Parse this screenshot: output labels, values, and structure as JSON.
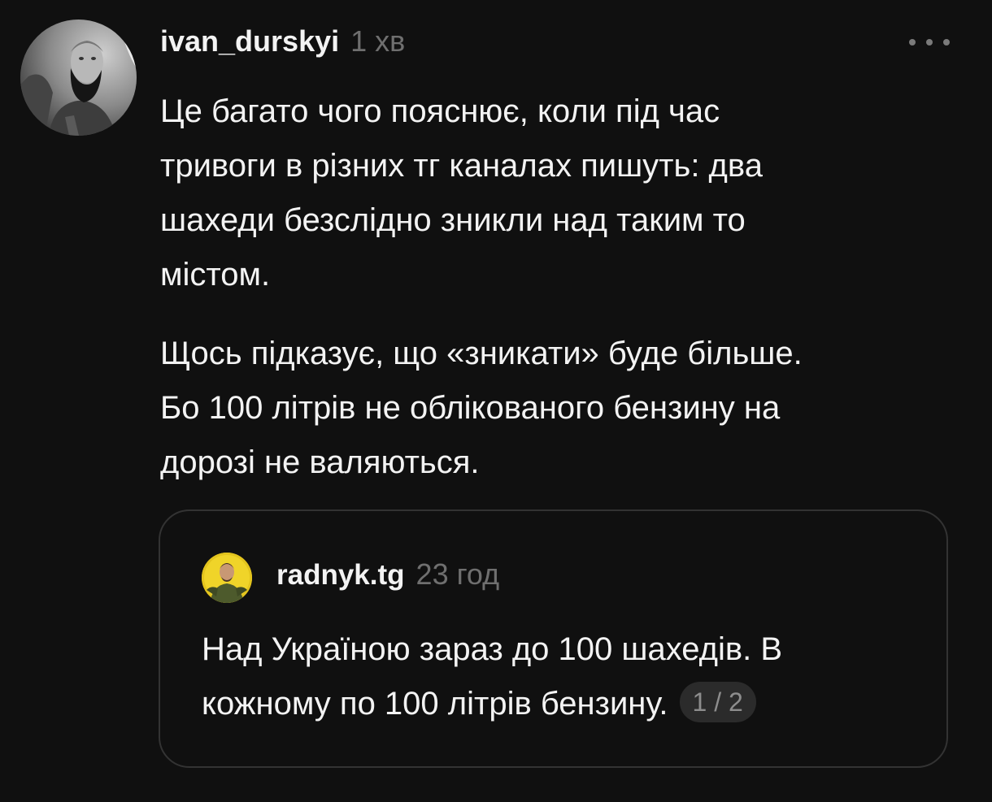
{
  "post": {
    "username": "ivan_durskyi",
    "timestamp": "1 хв",
    "paragraphs": [
      "Це багато чого пояснює, коли під час\nтривоги в різних тг каналах пишуть: два\nшахеди безслідно зникли над таким то\nмістом.",
      "Щось підказує, що «зникати» буде більше.\nБо 100 літрів не облікованого бензину на\nдорозі не валяються."
    ],
    "more_icon": "more-horizontal-icon"
  },
  "quoted_post": {
    "username": "radnyk.tg",
    "timestamp": "23 год",
    "text_line1": "Над Україною зараз до 100 шахедів. В",
    "text_line2": "кожному по 100 літрів бензину.",
    "pager": "1 / 2"
  },
  "colors": {
    "background": "#101010",
    "text": "#f3f3f3",
    "muted": "#6f6f6f",
    "border": "#333333",
    "pill": "#2b2b2b"
  }
}
